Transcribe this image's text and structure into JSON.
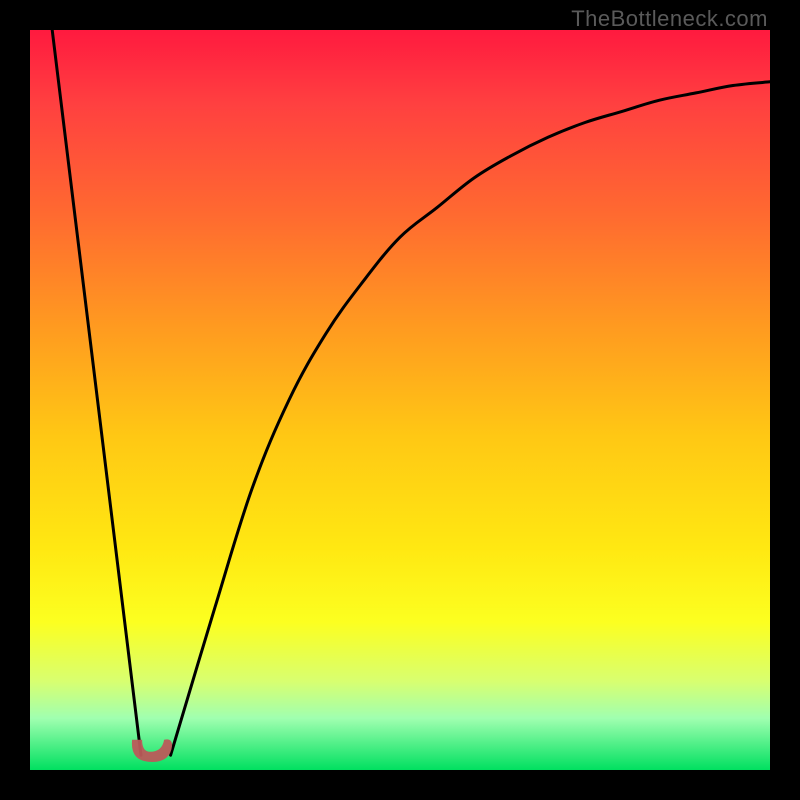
{
  "watermark": "TheBottleneck.com",
  "colors": {
    "frame": "#000000",
    "gradient_top": "#ff1a3f",
    "gradient_bottom": "#00e060",
    "curve_stroke": "#000000",
    "blob_fill": "#bb5a5a"
  },
  "chart_data": {
    "type": "line",
    "title": "",
    "xlabel": "",
    "ylabel": "",
    "xlim": [
      0,
      100
    ],
    "ylim": [
      0,
      100
    ],
    "series": [
      {
        "name": "left-slope",
        "x": [
          3,
          15
        ],
        "values": [
          100,
          2
        ]
      },
      {
        "name": "right-curve",
        "x": [
          19,
          25,
          30,
          35,
          40,
          45,
          50,
          55,
          60,
          65,
          70,
          75,
          80,
          85,
          90,
          95,
          100
        ],
        "values": [
          2,
          22,
          38,
          50,
          59,
          66,
          72,
          76,
          80,
          83,
          85.5,
          87.5,
          89,
          90.5,
          91.5,
          92.5,
          93
        ]
      }
    ],
    "annotations": [
      {
        "name": "blob",
        "x": 16.5,
        "y": 3,
        "shape": "hook"
      }
    ]
  }
}
